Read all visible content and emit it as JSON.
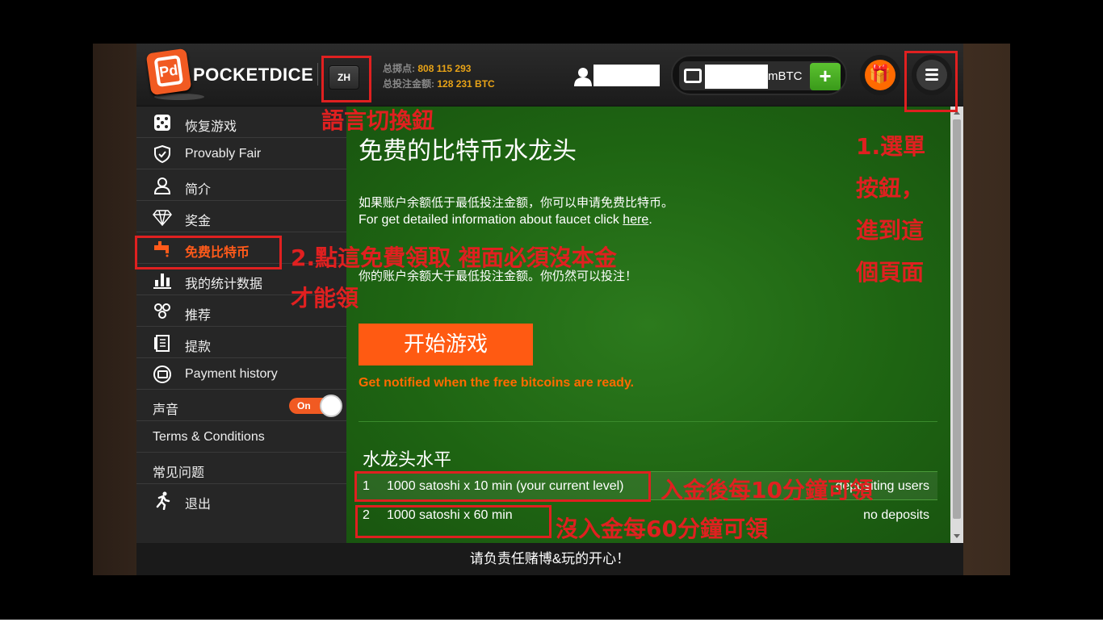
{
  "header": {
    "logo_text": "POCKETDICE",
    "lang_button": "ZH",
    "stats": [
      {
        "label": "总掷点: ",
        "value": "808 115 293"
      },
      {
        "label": "总投注金额: ",
        "value": "128 231 BTC"
      }
    ],
    "wallet_unit": "mBTC",
    "add_label": "+",
    "gift_icon": "gift-icon",
    "menu_icon": "hamburger-icon"
  },
  "sidebar": {
    "items": [
      {
        "label": "恢复游戏",
        "icon": "dice-icon"
      },
      {
        "label": "Provably Fair",
        "icon": "shield-check-icon"
      },
      {
        "label": "简介",
        "icon": "user-icon"
      },
      {
        "label": "奖金",
        "icon": "diamond-icon"
      },
      {
        "label": "免费比特币",
        "icon": "faucet-icon"
      },
      {
        "label": "我的统计数据",
        "icon": "bar-chart-icon"
      },
      {
        "label": "推荐",
        "icon": "group-icon"
      },
      {
        "label": "提款",
        "icon": "document-icon"
      },
      {
        "label": "Payment history",
        "icon": "wallet-icon"
      }
    ],
    "sound_label": "声音",
    "sound_toggle": "On",
    "terms": "Terms & Conditions",
    "faq": "常见问题",
    "logout": "退出"
  },
  "main": {
    "title": "免费的比特币水龙头",
    "p1": "如果账户余额低于最低投注金额，你可以申请免费比特币。",
    "p2_text": "For get detailed information about faucet click ",
    "p2_link": "here",
    "p2_end": ".",
    "p3": "你的账户余额大于最低投注金额。你仍然可以投注！",
    "play_button": "开始游戏",
    "notify": "Get notified when the free bitcoins are ready.",
    "level_title": "水龙头水平",
    "levels": [
      {
        "num": "1",
        "desc": "1000 satoshi x 10 min  (your current level)",
        "req": "depositing users"
      },
      {
        "num": "2",
        "desc": "1000 satoshi x 60 min",
        "req": "no deposits"
      }
    ]
  },
  "footer": "请负责任赌博&玩的开心！",
  "annotations": {
    "lang": "語言切換鈕",
    "menu_lines": [
      "1.選單",
      "按鈕，",
      "進到這",
      "個頁面"
    ],
    "faucet_line1": "2.點這免費領取 裡面必須沒本金",
    "faucet_line2": "才能領",
    "level1": "入金後每10分鐘可領",
    "level2": "沒入金每60分鐘可領"
  },
  "colors": {
    "accent": "#ff5a12",
    "annotation": "#e02020",
    "table_green": "#1e6412"
  }
}
